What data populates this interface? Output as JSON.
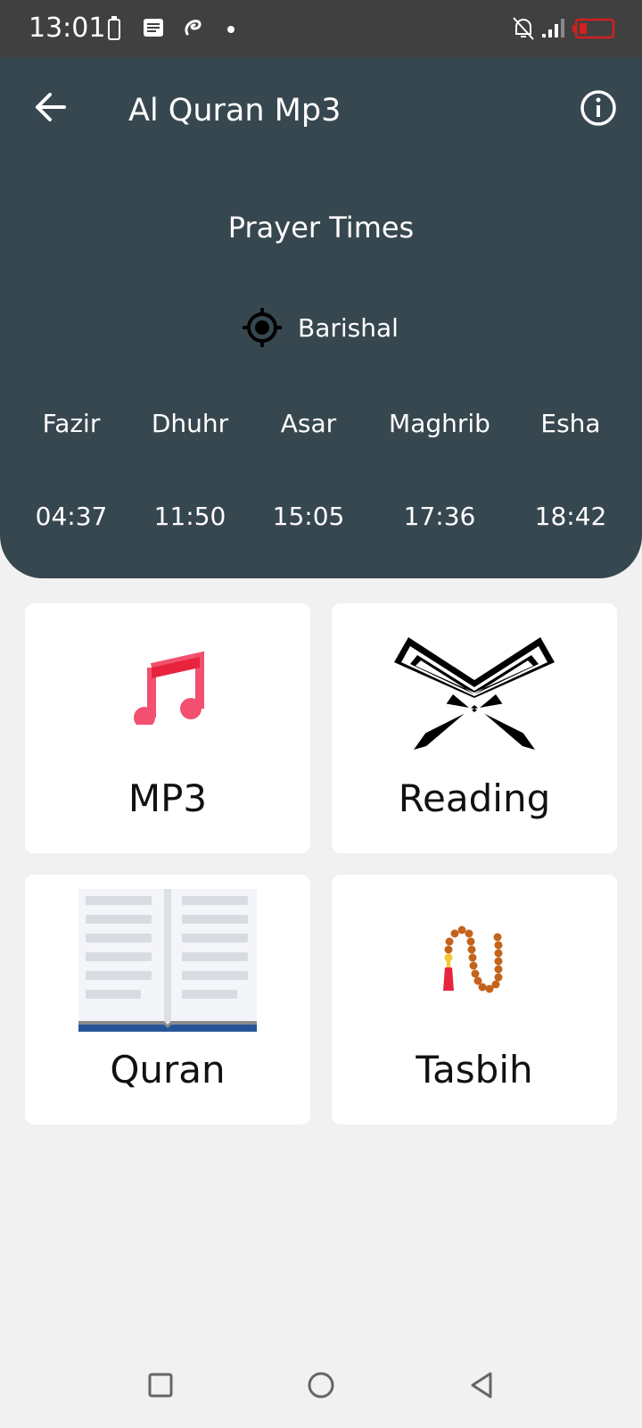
{
  "status_bar": {
    "time": "13:01",
    "icons": [
      "battery-outline-icon",
      "message-icon",
      "airtel-icon",
      "dot-icon",
      "mute-icon",
      "signal-icon",
      "battery-low-icon"
    ]
  },
  "app_bar": {
    "title": "Al Quran Mp3",
    "back_icon": "arrow-left-icon",
    "info_icon": "info-circle-icon"
  },
  "prayer": {
    "section_title": "Prayer Times",
    "location": "Barishal",
    "times": [
      {
        "name": "Fazir",
        "time": "04:37"
      },
      {
        "name": "Dhuhr",
        "time": "11:50"
      },
      {
        "name": "Asar",
        "time": "15:05"
      },
      {
        "name": "Maghrib",
        "time": "17:36"
      },
      {
        "name": "Esha",
        "time": "18:42"
      }
    ]
  },
  "menu": {
    "cards": [
      {
        "label": "MP3",
        "icon": "music-note-icon"
      },
      {
        "label": "Reading",
        "icon": "quran-stand-icon"
      },
      {
        "label": "Quran",
        "icon": "open-book-icon"
      },
      {
        "label": "Tasbih",
        "icon": "prayer-beads-icon"
      }
    ]
  },
  "colors": {
    "header_bg": "#37474f",
    "music_note": "#f2506e",
    "background": "#f1f1f1"
  }
}
